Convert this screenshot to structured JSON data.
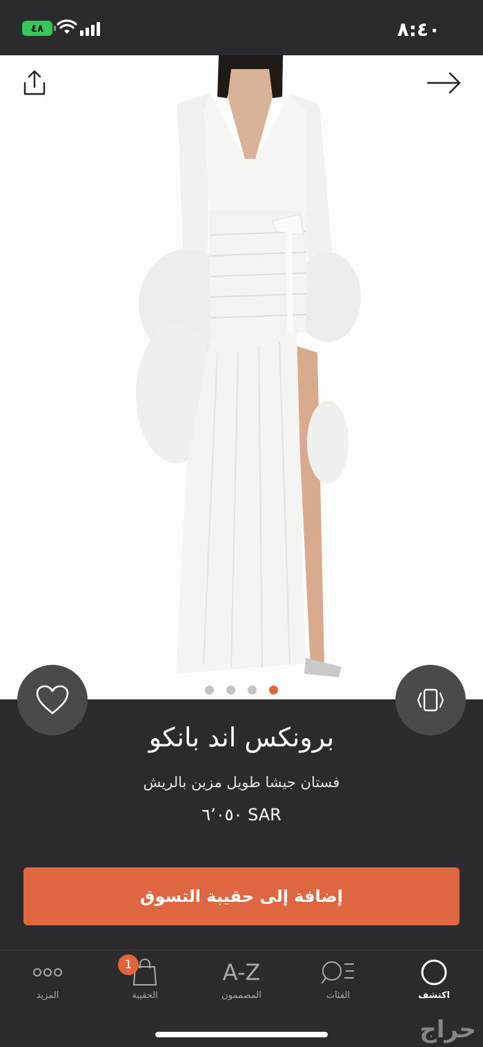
{
  "status_bar": {
    "time": "٨:٤٠",
    "battery": "٤٨"
  },
  "product": {
    "brand": "برونكس اند بانكو",
    "description": "فستان جيشا طويل مزين بالريش",
    "price": "٦٬٠٥٠ SAR",
    "image_count": 4,
    "active_image_index": 3
  },
  "actions": {
    "add_to_bag": "إضافة إلى حقيبة التسوق"
  },
  "tab_bar": {
    "discover": "اكتشف",
    "categories": "الفئات",
    "designers": "المصممون",
    "designers_icon_text": "A-Z",
    "bag": "الحقيبة",
    "bag_badge": "1",
    "more": "المزيد"
  },
  "icons": {
    "share": "share-icon",
    "back": "arrow-right-icon",
    "favorite": "heart-icon",
    "rotate": "rotate-view-icon"
  },
  "colors": {
    "accent": "#de6640",
    "background_dark": "#2b2b2d",
    "battery": "#34c759"
  },
  "watermark": "حراج"
}
